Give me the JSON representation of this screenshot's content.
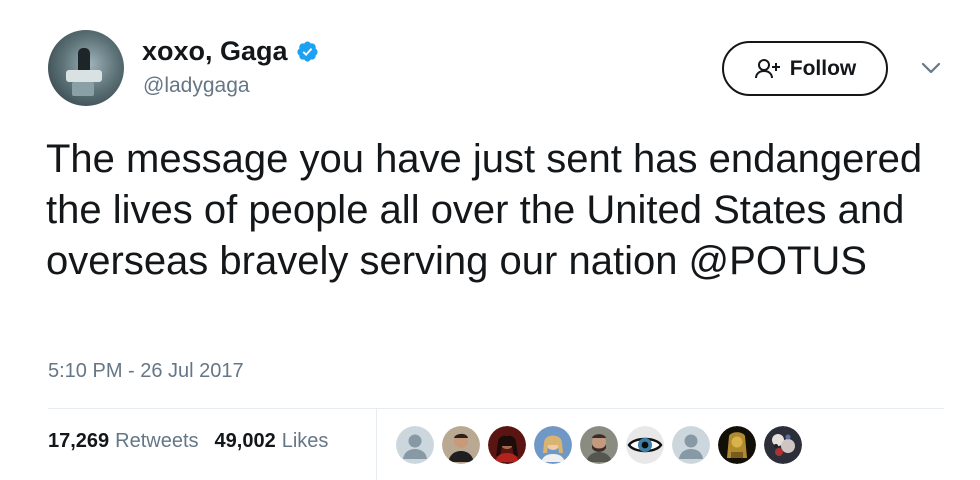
{
  "user": {
    "display_name": "xoxo, Gaga",
    "handle": "@ladygaga",
    "verified": true,
    "avatar_icon": "profile-photo"
  },
  "follow_button": {
    "label": "Follow",
    "icon": "add-person-icon"
  },
  "menu_icon": "chevron-down-icon",
  "tweet": {
    "text": "The message you have just sent has endangered the lives of people all over the United States and overseas bravely serving our nation @POTUS",
    "timestamp": "5:10 PM - 26 Jul 2017"
  },
  "stats": {
    "retweets_count": "17,269",
    "retweets_label": "Retweets",
    "likes_count": "49,002",
    "likes_label": "Likes"
  },
  "likers": [
    {
      "icon": "default-avatar"
    },
    {
      "icon": "user-avatar"
    },
    {
      "icon": "user-avatar"
    },
    {
      "icon": "user-avatar"
    },
    {
      "icon": "user-avatar"
    },
    {
      "icon": "eye-avatar"
    },
    {
      "icon": "default-avatar"
    },
    {
      "icon": "user-avatar"
    },
    {
      "icon": "user-avatar"
    }
  ],
  "colors": {
    "text": "#14171a",
    "secondary": "#657786",
    "verified_blue": "#1da1f2",
    "divider": "#e6ecf0"
  }
}
